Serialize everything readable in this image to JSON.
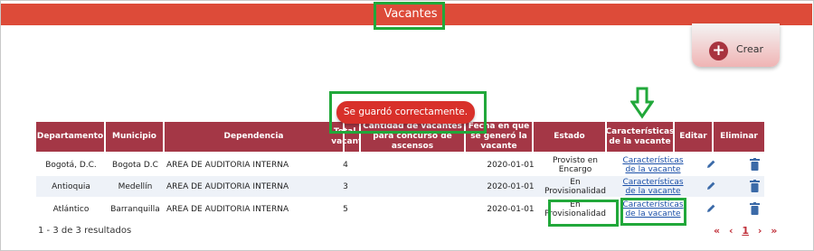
{
  "header": {
    "title": "Vacantes"
  },
  "create": {
    "label": "Crear"
  },
  "toast": {
    "message": "Se guardó correctamente."
  },
  "table": {
    "headers": {
      "departamento": "Departamento",
      "municipio": "Municipio",
      "dependencia": "Dependencia",
      "total": "Total de vacantes",
      "cantidad": "Cantidad de vacantes para concurso de ascensos",
      "fecha": "Fecha en que se generó la vacante",
      "estado": "Estado",
      "caracteristicas": "Características de la vacante",
      "editar": "Editar",
      "eliminar": "Eliminar"
    },
    "rows": [
      {
        "departamento": "Bogotá, D.C.",
        "municipio": "Bogota D.C",
        "dependencia": "AREA DE AUDITORIA INTERNA",
        "total": "4",
        "fecha": "2020-01-01",
        "estado": "Provisto en Encargo",
        "caracteristicas": "Características de la vacante"
      },
      {
        "departamento": "Antioquia",
        "municipio": "Medellín",
        "dependencia": "AREA DE AUDITORIA INTERNA",
        "total": "3",
        "fecha": "2020-01-01",
        "estado": "En Provisionalidad",
        "caracteristicas": "Características de la vacante"
      },
      {
        "departamento": "Atlántico",
        "municipio": "Barranquilla",
        "dependencia": "AREA DE AUDITORIA INTERNA",
        "total": "5",
        "fecha": "2020-01-01",
        "estado": "En Provisionalidad",
        "caracteristicas": "Características de la vacante"
      }
    ]
  },
  "footer": {
    "results": "1 - 3 de 3 resultados"
  },
  "pagination": {
    "first": "«",
    "prev": "‹",
    "page": "1",
    "next": "›",
    "last": "»"
  },
  "icons": {
    "create": "plus-circle-icon",
    "edit": "pencil-icon",
    "delete": "trash-icon",
    "annotation": "arrow-down-icon"
  },
  "colors": {
    "topbar": "#dd4b39",
    "header": "#a43746",
    "toast": "#d8302a",
    "highlight": "#21a83a",
    "link": "#1a4fa8"
  }
}
